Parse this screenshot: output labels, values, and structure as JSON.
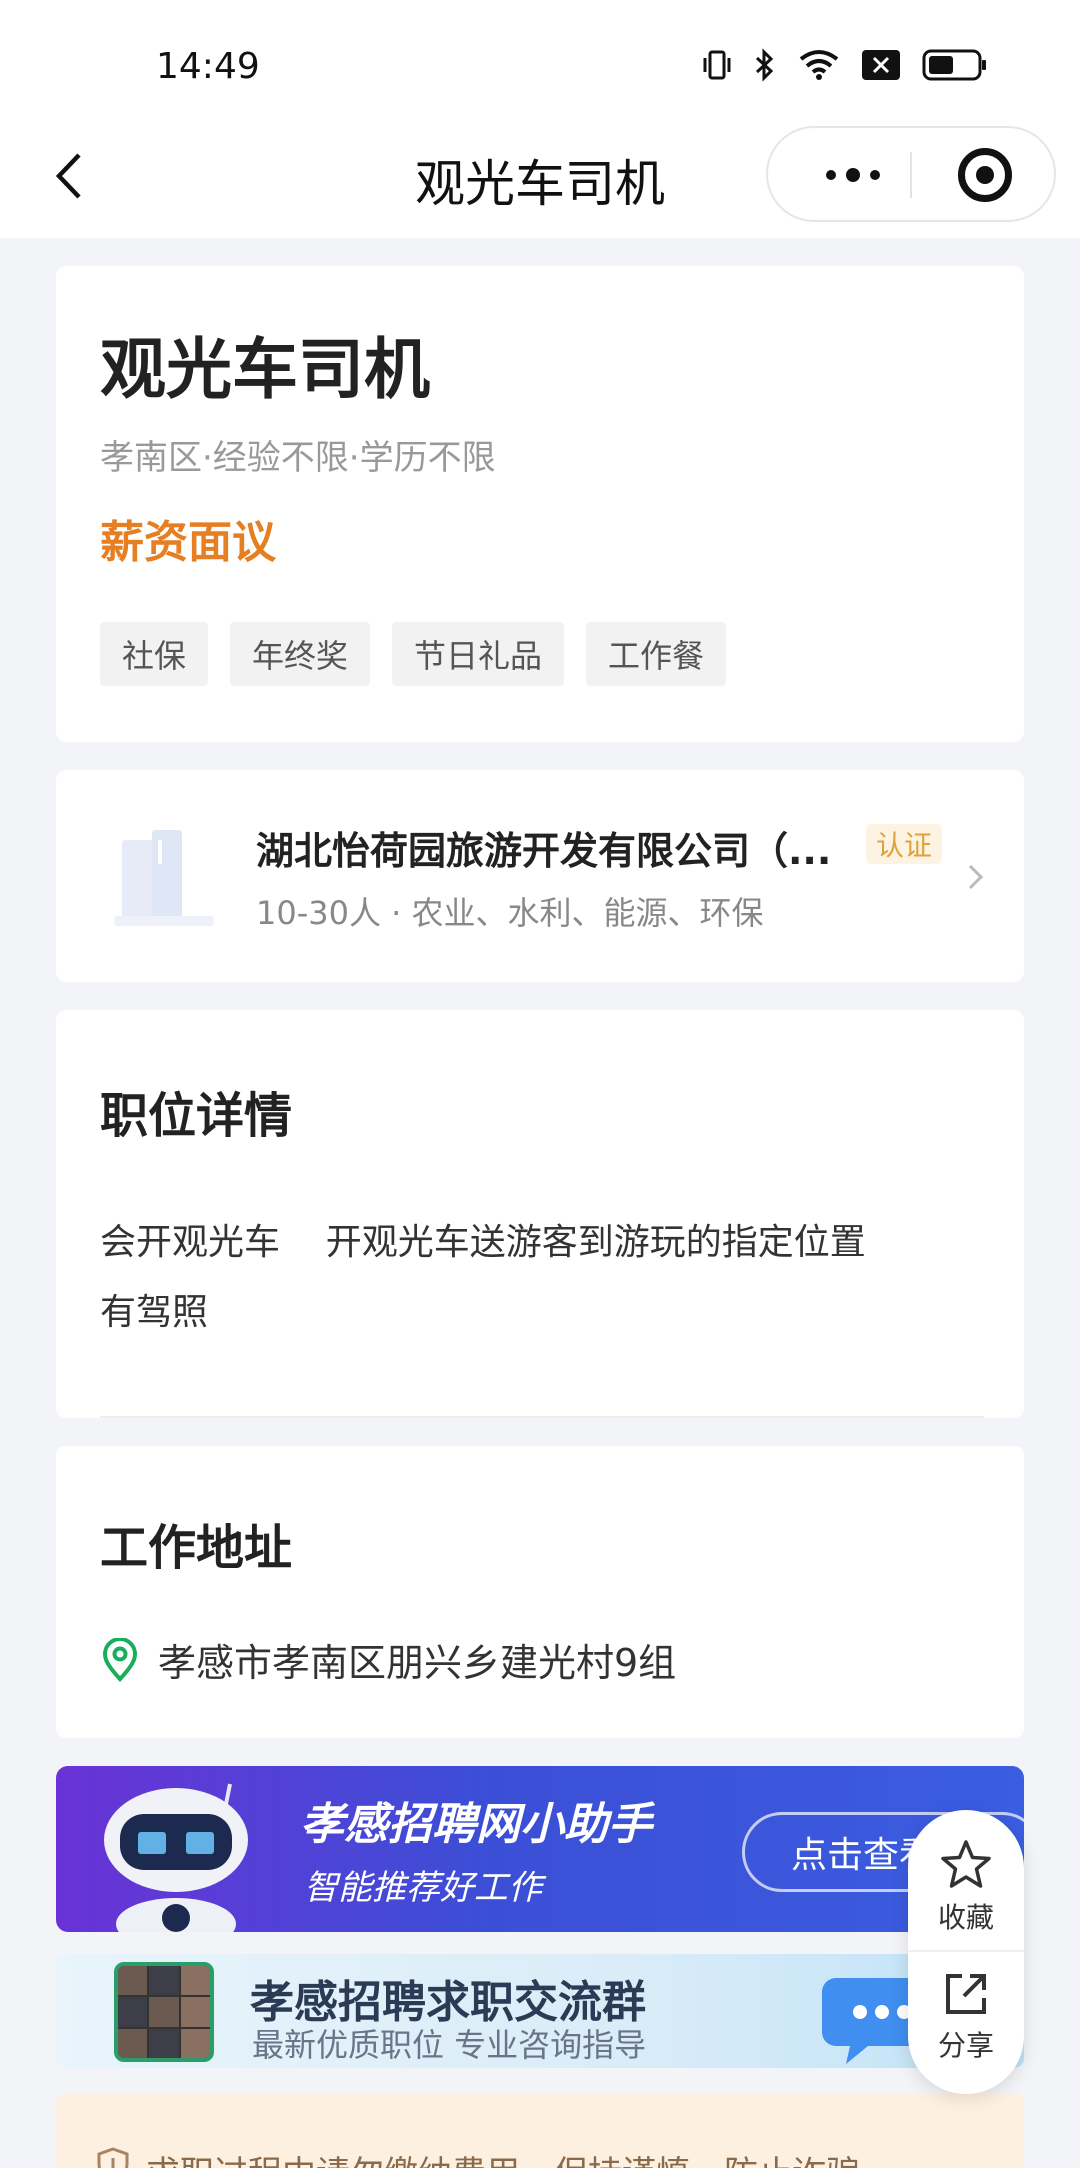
{
  "status_bar": {
    "time": "14:49",
    "icons": [
      "vibrate-icon",
      "bluetooth-icon",
      "wifi-icon",
      "no-sim-icon",
      "battery-icon"
    ]
  },
  "navbar": {
    "title": "观光车司机",
    "back_icon": "chevron-left-icon",
    "more_icon": "more-dots-icon",
    "close_icon": "target-circle-icon"
  },
  "job": {
    "title": "观光车司机",
    "meta": "孝南区·经验不限·学历不限",
    "salary": "薪资面议",
    "salary_color": "#e67e22",
    "tags": [
      "社保",
      "年终奖",
      "节日礼品",
      "工作餐"
    ]
  },
  "company": {
    "name": "湖北怡荷园旅游开发有限公司（...",
    "badge": "认证",
    "meta": "10-30人 · 农业、水利、能源、环保"
  },
  "details": {
    "title": "职位详情",
    "lines": [
      "会开观光车    开观光车送游客到游玩的指定位置",
      "有驾照"
    ]
  },
  "address": {
    "title": "工作地址",
    "text": "孝感市孝南区朋兴乡建光村9组",
    "icon_color": "#1aad5c"
  },
  "banner_assistant": {
    "title": "孝感招聘网小助手",
    "subtitle": "智能推荐好工作",
    "button": "点击查看"
  },
  "banner_group": {
    "title": "孝感招聘求职交流群",
    "subtitle": "最新优质职位 专业咨询指导"
  },
  "notice": {
    "text": "求职过程中请勿缴纳费用，保持谨慎，防止诈骗"
  },
  "floating_actions": {
    "favorite": "收藏",
    "share": "分享"
  }
}
